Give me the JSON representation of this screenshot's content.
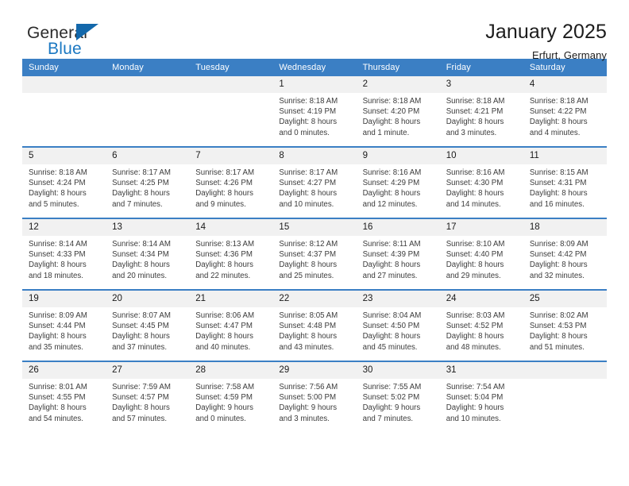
{
  "brand": {
    "word_one": "General",
    "word_two": "Blue",
    "flag_icon": "triangle-flag-icon",
    "accent_color": "#1368ab"
  },
  "header": {
    "title": "January 2025",
    "location": "Erfurt, Germany"
  },
  "theme": {
    "header_blue": "#3b7fc4",
    "daynum_gray": "#f1f1f1",
    "text": "#1a1a1a"
  },
  "calendar": {
    "weekday_headers": [
      "Sunday",
      "Monday",
      "Tuesday",
      "Wednesday",
      "Thursday",
      "Friday",
      "Saturday"
    ],
    "labels": {
      "sunrise": "Sunrise:",
      "sunset": "Sunset:",
      "daylight": "Daylight:"
    },
    "weeks": [
      [
        {
          "day": "",
          "sunrise": "",
          "sunset": "",
          "daylight_line1": "",
          "daylight_line2": ""
        },
        {
          "day": "",
          "sunrise": "",
          "sunset": "",
          "daylight_line1": "",
          "daylight_line2": ""
        },
        {
          "day": "",
          "sunrise": "",
          "sunset": "",
          "daylight_line1": "",
          "daylight_line2": ""
        },
        {
          "day": "1",
          "sunrise": "Sunrise: 8:18 AM",
          "sunset": "Sunset: 4:19 PM",
          "daylight_line1": "Daylight: 8 hours",
          "daylight_line2": "and 0 minutes."
        },
        {
          "day": "2",
          "sunrise": "Sunrise: 8:18 AM",
          "sunset": "Sunset: 4:20 PM",
          "daylight_line1": "Daylight: 8 hours",
          "daylight_line2": "and 1 minute."
        },
        {
          "day": "3",
          "sunrise": "Sunrise: 8:18 AM",
          "sunset": "Sunset: 4:21 PM",
          "daylight_line1": "Daylight: 8 hours",
          "daylight_line2": "and 3 minutes."
        },
        {
          "day": "4",
          "sunrise": "Sunrise: 8:18 AM",
          "sunset": "Sunset: 4:22 PM",
          "daylight_line1": "Daylight: 8 hours",
          "daylight_line2": "and 4 minutes."
        }
      ],
      [
        {
          "day": "5",
          "sunrise": "Sunrise: 8:18 AM",
          "sunset": "Sunset: 4:24 PM",
          "daylight_line1": "Daylight: 8 hours",
          "daylight_line2": "and 5 minutes."
        },
        {
          "day": "6",
          "sunrise": "Sunrise: 8:17 AM",
          "sunset": "Sunset: 4:25 PM",
          "daylight_line1": "Daylight: 8 hours",
          "daylight_line2": "and 7 minutes."
        },
        {
          "day": "7",
          "sunrise": "Sunrise: 8:17 AM",
          "sunset": "Sunset: 4:26 PM",
          "daylight_line1": "Daylight: 8 hours",
          "daylight_line2": "and 9 minutes."
        },
        {
          "day": "8",
          "sunrise": "Sunrise: 8:17 AM",
          "sunset": "Sunset: 4:27 PM",
          "daylight_line1": "Daylight: 8 hours",
          "daylight_line2": "and 10 minutes."
        },
        {
          "day": "9",
          "sunrise": "Sunrise: 8:16 AM",
          "sunset": "Sunset: 4:29 PM",
          "daylight_line1": "Daylight: 8 hours",
          "daylight_line2": "and 12 minutes."
        },
        {
          "day": "10",
          "sunrise": "Sunrise: 8:16 AM",
          "sunset": "Sunset: 4:30 PM",
          "daylight_line1": "Daylight: 8 hours",
          "daylight_line2": "and 14 minutes."
        },
        {
          "day": "11",
          "sunrise": "Sunrise: 8:15 AM",
          "sunset": "Sunset: 4:31 PM",
          "daylight_line1": "Daylight: 8 hours",
          "daylight_line2": "and 16 minutes."
        }
      ],
      [
        {
          "day": "12",
          "sunrise": "Sunrise: 8:14 AM",
          "sunset": "Sunset: 4:33 PM",
          "daylight_line1": "Daylight: 8 hours",
          "daylight_line2": "and 18 minutes."
        },
        {
          "day": "13",
          "sunrise": "Sunrise: 8:14 AM",
          "sunset": "Sunset: 4:34 PM",
          "daylight_line1": "Daylight: 8 hours",
          "daylight_line2": "and 20 minutes."
        },
        {
          "day": "14",
          "sunrise": "Sunrise: 8:13 AM",
          "sunset": "Sunset: 4:36 PM",
          "daylight_line1": "Daylight: 8 hours",
          "daylight_line2": "and 22 minutes."
        },
        {
          "day": "15",
          "sunrise": "Sunrise: 8:12 AM",
          "sunset": "Sunset: 4:37 PM",
          "daylight_line1": "Daylight: 8 hours",
          "daylight_line2": "and 25 minutes."
        },
        {
          "day": "16",
          "sunrise": "Sunrise: 8:11 AM",
          "sunset": "Sunset: 4:39 PM",
          "daylight_line1": "Daylight: 8 hours",
          "daylight_line2": "and 27 minutes."
        },
        {
          "day": "17",
          "sunrise": "Sunrise: 8:10 AM",
          "sunset": "Sunset: 4:40 PM",
          "daylight_line1": "Daylight: 8 hours",
          "daylight_line2": "and 29 minutes."
        },
        {
          "day": "18",
          "sunrise": "Sunrise: 8:09 AM",
          "sunset": "Sunset: 4:42 PM",
          "daylight_line1": "Daylight: 8 hours",
          "daylight_line2": "and 32 minutes."
        }
      ],
      [
        {
          "day": "19",
          "sunrise": "Sunrise: 8:09 AM",
          "sunset": "Sunset: 4:44 PM",
          "daylight_line1": "Daylight: 8 hours",
          "daylight_line2": "and 35 minutes."
        },
        {
          "day": "20",
          "sunrise": "Sunrise: 8:07 AM",
          "sunset": "Sunset: 4:45 PM",
          "daylight_line1": "Daylight: 8 hours",
          "daylight_line2": "and 37 minutes."
        },
        {
          "day": "21",
          "sunrise": "Sunrise: 8:06 AM",
          "sunset": "Sunset: 4:47 PM",
          "daylight_line1": "Daylight: 8 hours",
          "daylight_line2": "and 40 minutes."
        },
        {
          "day": "22",
          "sunrise": "Sunrise: 8:05 AM",
          "sunset": "Sunset: 4:48 PM",
          "daylight_line1": "Daylight: 8 hours",
          "daylight_line2": "and 43 minutes."
        },
        {
          "day": "23",
          "sunrise": "Sunrise: 8:04 AM",
          "sunset": "Sunset: 4:50 PM",
          "daylight_line1": "Daylight: 8 hours",
          "daylight_line2": "and 45 minutes."
        },
        {
          "day": "24",
          "sunrise": "Sunrise: 8:03 AM",
          "sunset": "Sunset: 4:52 PM",
          "daylight_line1": "Daylight: 8 hours",
          "daylight_line2": "and 48 minutes."
        },
        {
          "day": "25",
          "sunrise": "Sunrise: 8:02 AM",
          "sunset": "Sunset: 4:53 PM",
          "daylight_line1": "Daylight: 8 hours",
          "daylight_line2": "and 51 minutes."
        }
      ],
      [
        {
          "day": "26",
          "sunrise": "Sunrise: 8:01 AM",
          "sunset": "Sunset: 4:55 PM",
          "daylight_line1": "Daylight: 8 hours",
          "daylight_line2": "and 54 minutes."
        },
        {
          "day": "27",
          "sunrise": "Sunrise: 7:59 AM",
          "sunset": "Sunset: 4:57 PM",
          "daylight_line1": "Daylight: 8 hours",
          "daylight_line2": "and 57 minutes."
        },
        {
          "day": "28",
          "sunrise": "Sunrise: 7:58 AM",
          "sunset": "Sunset: 4:59 PM",
          "daylight_line1": "Daylight: 9 hours",
          "daylight_line2": "and 0 minutes."
        },
        {
          "day": "29",
          "sunrise": "Sunrise: 7:56 AM",
          "sunset": "Sunset: 5:00 PM",
          "daylight_line1": "Daylight: 9 hours",
          "daylight_line2": "and 3 minutes."
        },
        {
          "day": "30",
          "sunrise": "Sunrise: 7:55 AM",
          "sunset": "Sunset: 5:02 PM",
          "daylight_line1": "Daylight: 9 hours",
          "daylight_line2": "and 7 minutes."
        },
        {
          "day": "31",
          "sunrise": "Sunrise: 7:54 AM",
          "sunset": "Sunset: 5:04 PM",
          "daylight_line1": "Daylight: 9 hours",
          "daylight_line2": "and 10 minutes."
        },
        {
          "day": "",
          "sunrise": "",
          "sunset": "",
          "daylight_line1": "",
          "daylight_line2": ""
        }
      ]
    ]
  }
}
